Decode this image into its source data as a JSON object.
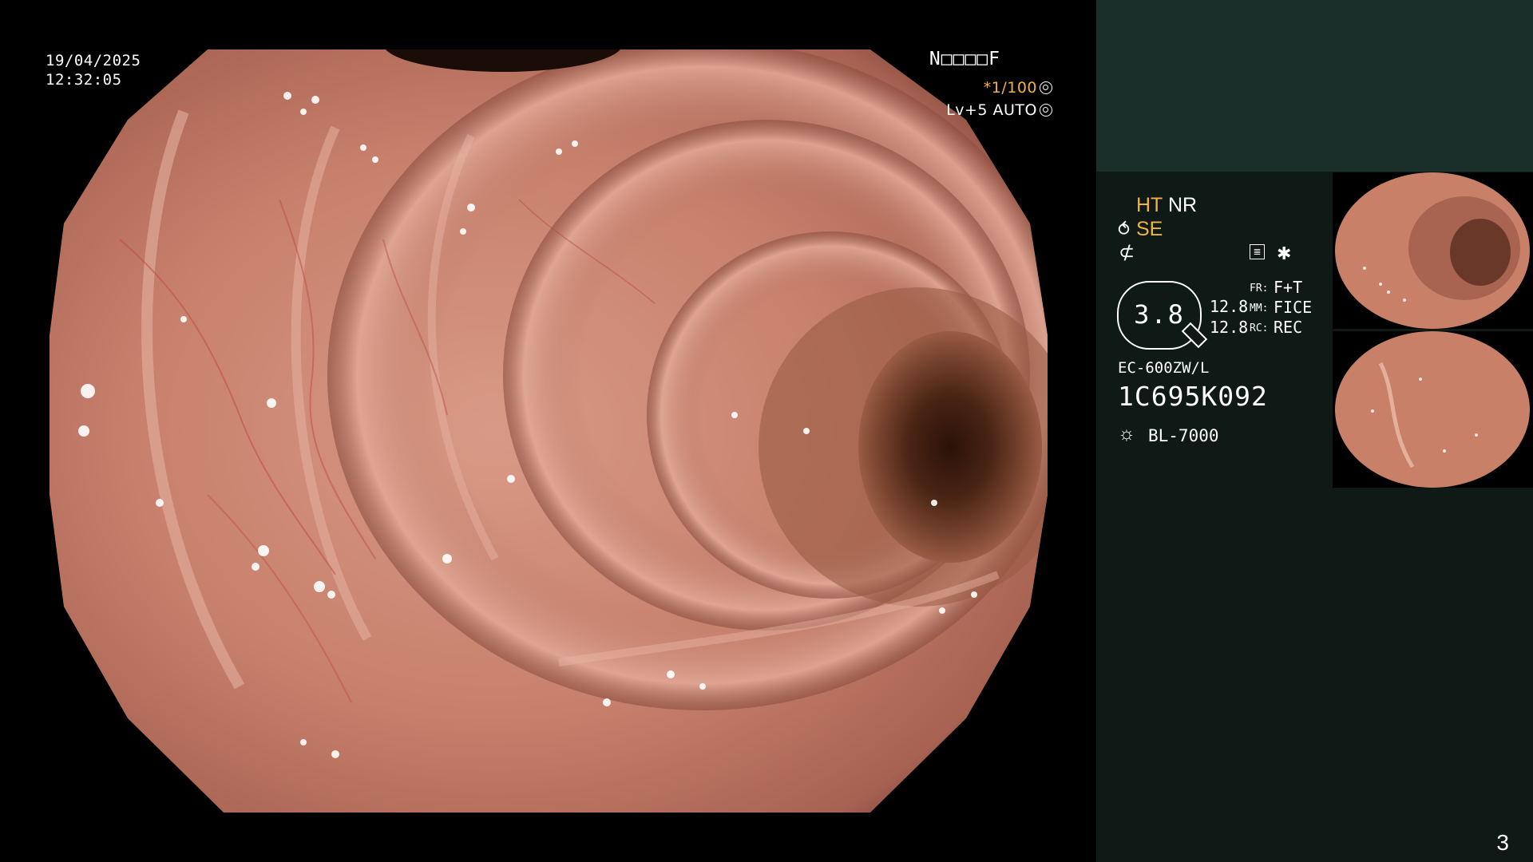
{
  "overlay": {
    "date": "19/04/2025",
    "time": "12:32:05",
    "patient_id": "N□□□□F",
    "shutter_speed": "*1/100",
    "shutter_icon": "shutter-icon",
    "brightness_level": "Lv+5",
    "brightness_mode": "AUTO",
    "brightness_icon": "iris-icon"
  },
  "panel": {
    "modes": {
      "ht": "HT",
      "nr": "NR",
      "se_icon": "⥀",
      "se": "SE",
      "f_icon": "⊄"
    },
    "settings_icon": "≣",
    "star_icon": "✱",
    "zoom": "3.8",
    "enhancement_1": "12.8",
    "enhancement_2": "12.8",
    "fr_label": "FR:",
    "fr_value": "F+T",
    "mm_label": "MM:",
    "mm_value": "FICE",
    "rc_label": "RC:",
    "rc_value": "REC",
    "scope_model": "EC-600ZW/L",
    "scope_serial": "1C695K092",
    "light_icon": "☼",
    "light_source": "BL-7000"
  },
  "page_number": "3",
  "colors": {
    "panel_bg": "#0f1a17",
    "panel_header_bg": "#1a2e2a",
    "accent": "#f0b43c",
    "text": "#ffffff"
  }
}
